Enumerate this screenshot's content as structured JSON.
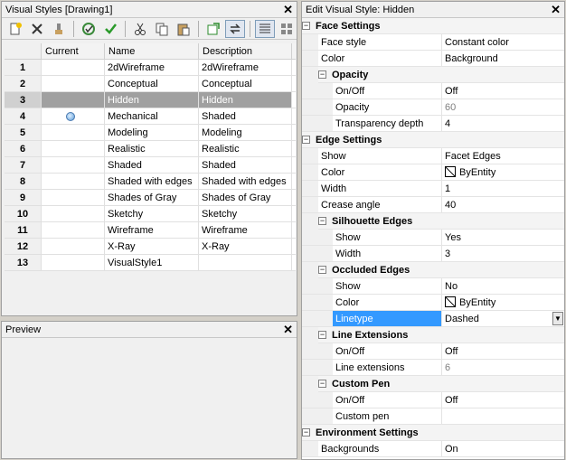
{
  "visual_styles_panel": {
    "title": "Visual Styles [Drawing1]",
    "close": "✕",
    "columns": [
      "Current",
      "Name",
      "Description"
    ],
    "rows": [
      {
        "num": "1",
        "name": "2dWireframe",
        "desc": "2dWireframe"
      },
      {
        "num": "2",
        "name": "Conceptual",
        "desc": "Conceptual"
      },
      {
        "num": "3",
        "name": "Hidden",
        "desc": "Hidden"
      },
      {
        "num": "4",
        "name": "Mechanical",
        "desc": "Shaded"
      },
      {
        "num": "5",
        "name": "Modeling",
        "desc": "Modeling"
      },
      {
        "num": "6",
        "name": "Realistic",
        "desc": "Realistic"
      },
      {
        "num": "7",
        "name": "Shaded",
        "desc": "Shaded"
      },
      {
        "num": "8",
        "name": "Shaded with edges",
        "desc": "Shaded with edges"
      },
      {
        "num": "9",
        "name": "Shades of Gray",
        "desc": "Shades of Gray"
      },
      {
        "num": "10",
        "name": "Sketchy",
        "desc": "Sketchy"
      },
      {
        "num": "11",
        "name": "Wireframe",
        "desc": "Wireframe"
      },
      {
        "num": "12",
        "name": "X-Ray",
        "desc": "X-Ray"
      },
      {
        "num": "13",
        "name": "VisualStyle1",
        "desc": ""
      }
    ],
    "selected_row": 3,
    "current_row": 4
  },
  "toolbar_icons": [
    "new-style-icon",
    "delete-icon",
    "brush-icon",
    "apply-to-viewport-icon",
    "set-current-icon",
    "cut-icon",
    "copy-icon",
    "paste-icon",
    "export-icon",
    "sync-icon",
    "details-view-icon",
    "grid-view-icon"
  ],
  "preview_panel": {
    "title": "Preview",
    "close": "✕"
  },
  "edit_panel": {
    "title": "Edit Visual Style: Hidden",
    "close": "✕",
    "face_settings": {
      "label": "Face Settings",
      "face_style": "Face style",
      "face_style_val": "Constant color",
      "color": "Color",
      "color_val": "Background"
    },
    "opacity": {
      "label": "Opacity",
      "onoff": "On/Off",
      "onoff_val": "Off",
      "opacity": "Opacity",
      "opacity_val": "60",
      "transparency": "Transparency depth",
      "transparency_val": "4"
    },
    "edge_settings": {
      "label": "Edge Settings",
      "show": "Show",
      "show_val": "Facet Edges",
      "color": "Color",
      "color_val": "ByEntity",
      "width": "Width",
      "width_val": "1",
      "crease": "Crease angle",
      "crease_val": "40"
    },
    "silhouette": {
      "label": "Silhouette Edges",
      "show": "Show",
      "show_val": "Yes",
      "width": "Width",
      "width_val": "3"
    },
    "occluded": {
      "label": "Occluded Edges",
      "show": "Show",
      "show_val": "No",
      "color": "Color",
      "color_val": "ByEntity",
      "linetype": "Linetype",
      "linetype_val": "Dashed"
    },
    "line_ext": {
      "label": "Line Extensions",
      "onoff": "On/Off",
      "onoff_val": "Off",
      "ext": "Line extensions",
      "ext_val": "6"
    },
    "custom_pen": {
      "label": "Custom Pen",
      "onoff": "On/Off",
      "onoff_val": "Off",
      "pen": "Custom pen",
      "pen_val": ""
    },
    "environment": {
      "label": "Environment Settings",
      "backgrounds": "Backgrounds",
      "backgrounds_val": "On"
    }
  }
}
